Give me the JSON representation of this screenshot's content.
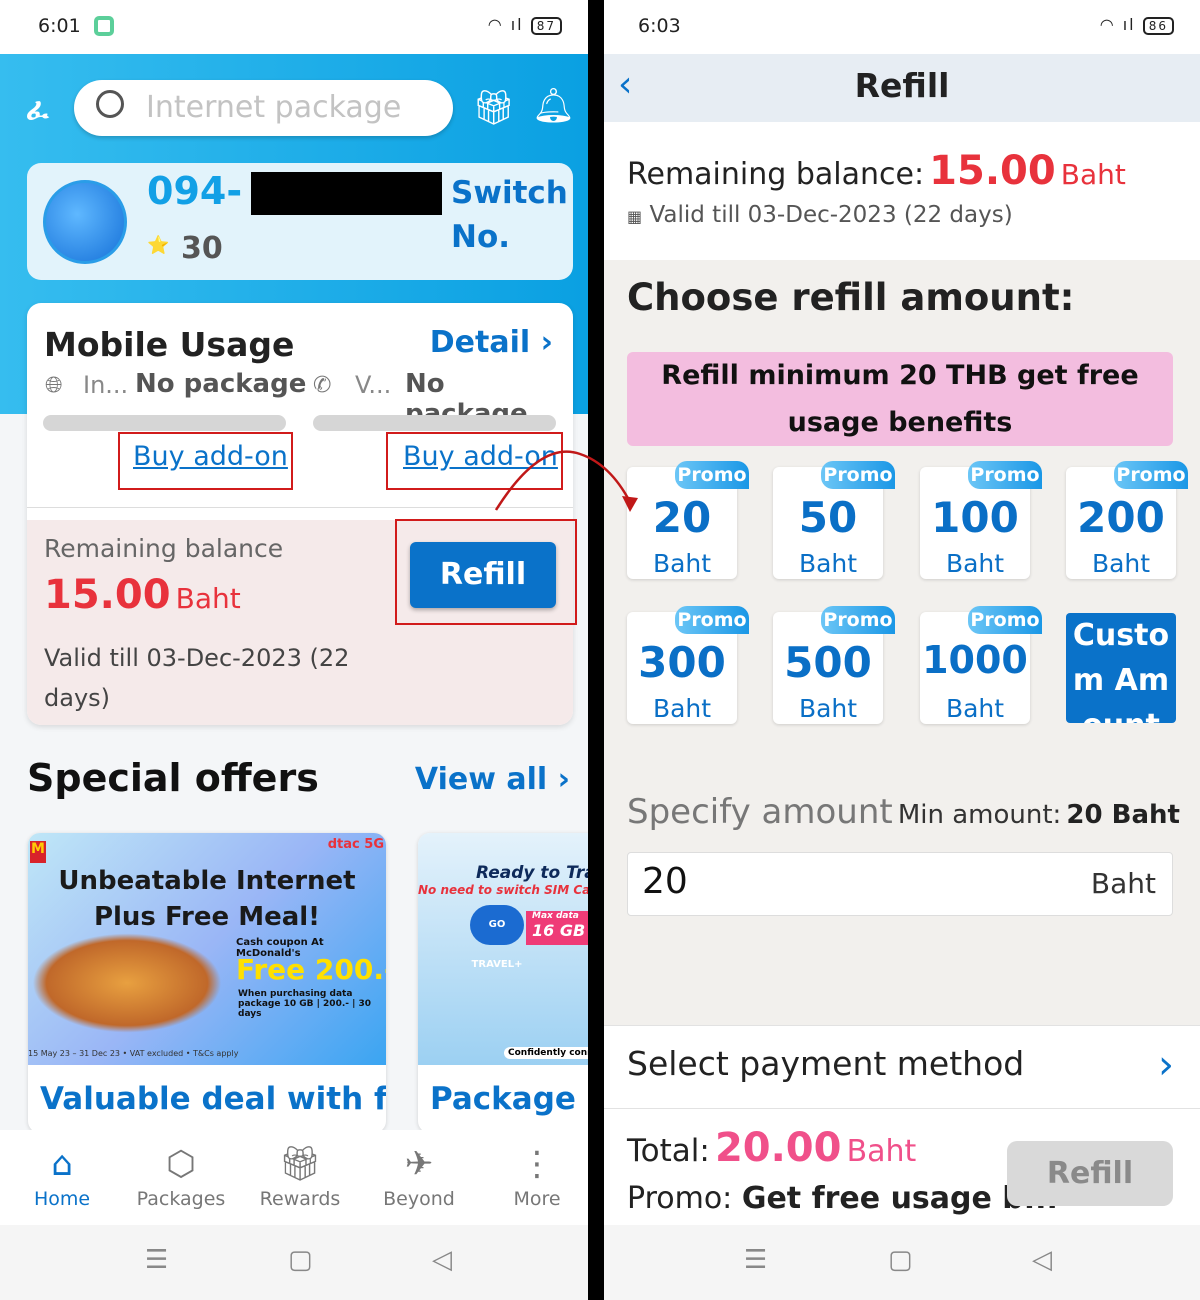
{
  "left": {
    "status": {
      "time": "6:01",
      "battery": "87"
    },
    "search": {
      "placeholder": "Internet package"
    },
    "account": {
      "number_prefix": "094-",
      "points": "30",
      "switch_label": "Switch No."
    },
    "usage": {
      "title": "Mobile Usage",
      "detail_label": "Detail ›",
      "internet_label": "In...",
      "internet_value": "No package",
      "voice_label": "V...",
      "voice_value": "No package",
      "buy_addon_1": "Buy add-on",
      "buy_addon_2": "Buy add-on"
    },
    "balance": {
      "label": "Remaining balance",
      "amount": "15.00",
      "unit": "Baht",
      "valid": "Valid till 03-Dec-2023 (22 days)",
      "refill_label": "Refill"
    },
    "offers": {
      "title": "Special offers",
      "view_all": "View all ›",
      "items": [
        {
          "title": "Valuable deal with fr...",
          "banner_headline": "Unbeatable Internet Plus Free Meal!",
          "banner_sub": "Cash coupon At McDonald's",
          "banner_price": "Free 200.-",
          "banner_cond": "When purchasing data package 10 GB | 200.- | 30 days",
          "banner_terms": "15 May 23 – 31 Dec 23 • VAT excluded • T&Cs apply",
          "brand": "dtac 5G"
        },
        {
          "title": "Package",
          "banner_headline": "Ready to Tra",
          "banner_sub": "No need to switch SIM Card",
          "banner_badge": "GO TRAVEL+",
          "banner_data_label": "Max data",
          "banner_data": "16 GB",
          "banner_foot": "Confidently connecte"
        }
      ]
    },
    "nav": [
      {
        "label": "Home",
        "icon": "home-icon",
        "active": true
      },
      {
        "label": "Packages",
        "icon": "box-icon"
      },
      {
        "label": "Rewards",
        "icon": "gift-icon"
      },
      {
        "label": "Beyond",
        "icon": "plane-icon"
      },
      {
        "label": "More",
        "icon": "more-icon"
      }
    ]
  },
  "right": {
    "status": {
      "time": "6:03",
      "battery": "86"
    },
    "title": "Refill",
    "balance": {
      "label": "Remaining balance:",
      "amount": "15.00",
      "unit": "Baht",
      "valid": "Valid till 03-Dec-2023 (22 days)"
    },
    "choose_title": "Choose refill amount:",
    "promo_banner": "Refill minimum 20 THB get free usage benefits",
    "tiles": [
      {
        "badge": "Promo",
        "amount": "20",
        "unit": "Baht"
      },
      {
        "badge": "Promo",
        "amount": "50",
        "unit": "Baht"
      },
      {
        "badge": "Promo",
        "amount": "100",
        "unit": "Baht"
      },
      {
        "badge": "Promo",
        "amount": "200",
        "unit": "Baht"
      },
      {
        "badge": "Promo",
        "amount": "300",
        "unit": "Baht"
      },
      {
        "badge": "Promo",
        "amount": "500",
        "unit": "Baht"
      },
      {
        "badge": "Promo",
        "amount": "1000",
        "unit": "Baht"
      }
    ],
    "custom_amount": "Custom Amount",
    "specify": {
      "label": "Specify amount",
      "min_label": "Min amount:",
      "min_value": "20 Baht",
      "value": "20",
      "unit": "Baht"
    },
    "payment_label": "Select payment method",
    "total": {
      "label": "Total:",
      "amount": "20.00",
      "unit": "Baht",
      "promo_label": "Promo:",
      "promo_value": "Get free usage b...",
      "refill_label": "Refill"
    }
  },
  "colors": {
    "brand_blue": "#0a72c9",
    "accent_red": "#e8323c",
    "annotation_red": "#d11b1b",
    "header_blue": "#1aaae6"
  }
}
